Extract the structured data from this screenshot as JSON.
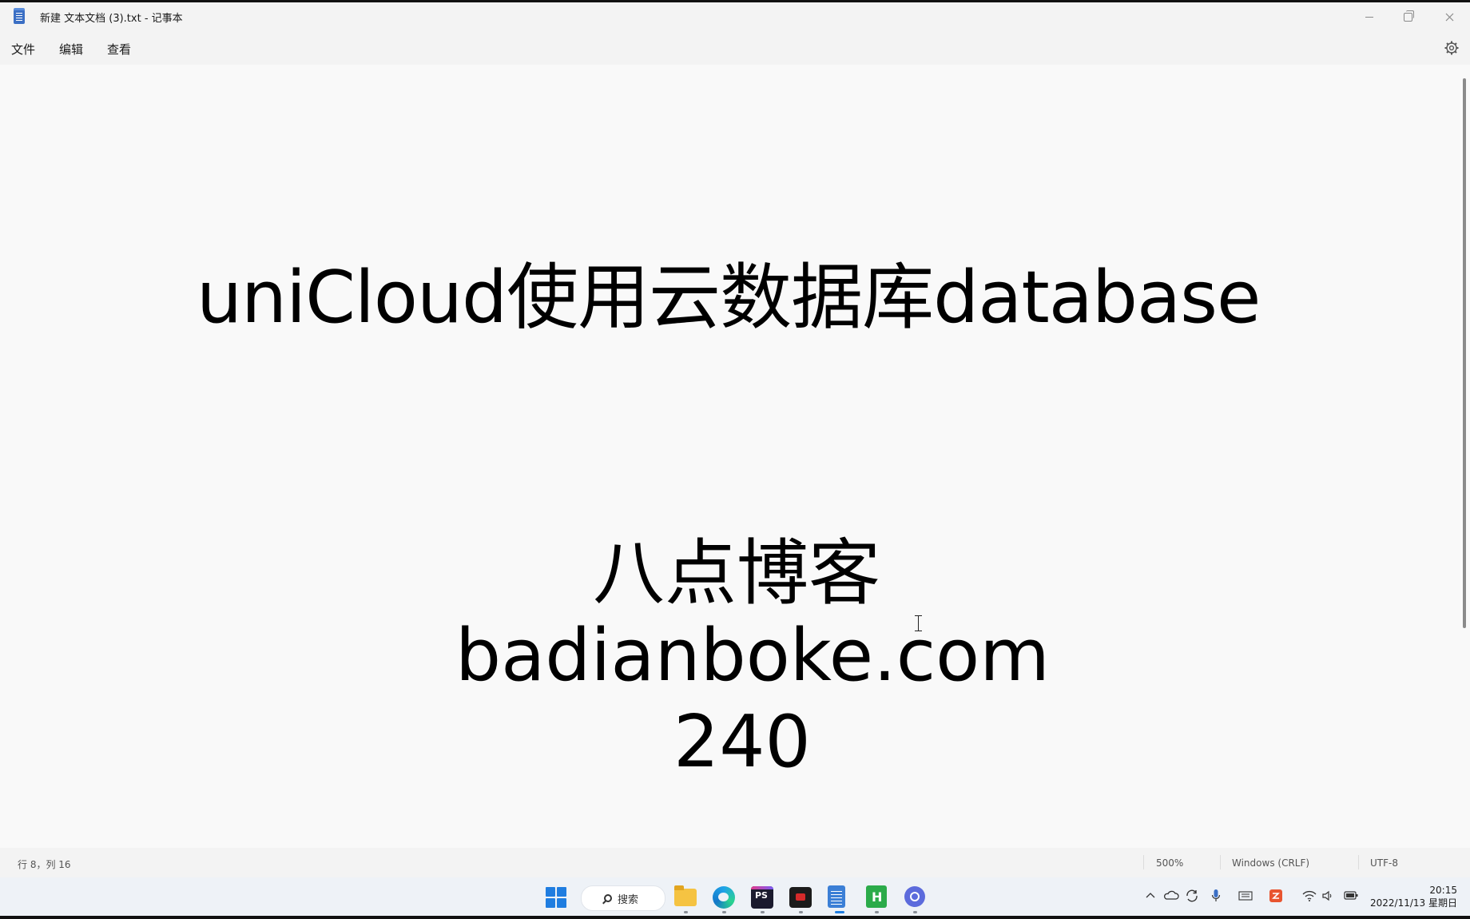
{
  "window": {
    "title": "新建 文本文档 (3).txt - 记事本"
  },
  "menu": {
    "file": "文件",
    "edit": "编辑",
    "view": "查看"
  },
  "document": {
    "lines": [
      "uniCloud使用云数据库database",
      "八点博客",
      "badianboke.com",
      "240"
    ]
  },
  "status": {
    "position": "行 8，列 16",
    "zoom": "500%",
    "line_ending": "Windows (CRLF)",
    "encoding": "UTF-8"
  },
  "taskbar": {
    "search_label": "搜索",
    "pinned_apps": [
      "windows-start",
      "file-explorer",
      "edge",
      "phpstorm",
      "screen-recorder",
      "notepad",
      "hbuilderx",
      "app"
    ],
    "clock_time": "20:15",
    "clock_date": "2022/11/13 星期日"
  },
  "colors": {
    "window_bg": "#f9f9f9",
    "chrome_bg": "#f3f3f3",
    "taskbar_bg": "#eef2f7",
    "accent": "#1f7de0"
  }
}
